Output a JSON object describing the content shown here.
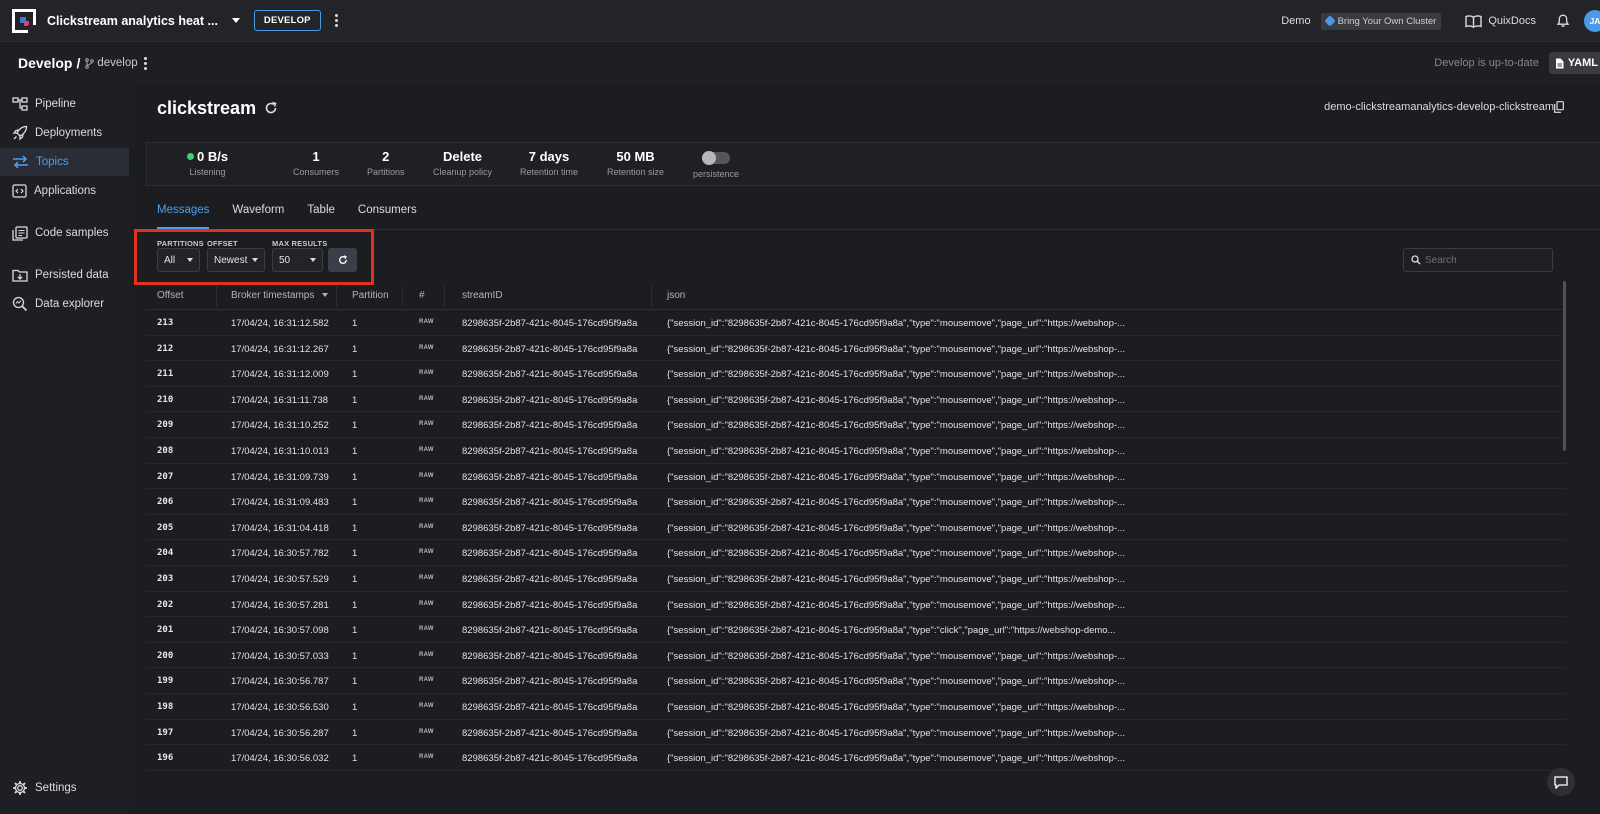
{
  "topbar": {
    "project_title": "Clickstream analytics heat ...",
    "environment_badge": "DEVELOP",
    "org_label": "Demo",
    "byoc_label": "Bring Your Own Cluster",
    "docs_label": "QuixDocs",
    "avatar_initials": "JA"
  },
  "subbar": {
    "crumb_root": "Develop",
    "crumb_separator": "/",
    "branch": "develop",
    "status": "Develop is up-to-date",
    "yaml_label": "YAML"
  },
  "sidebar": {
    "items": [
      {
        "label": "Pipeline",
        "icon": "pipeline-icon"
      },
      {
        "label": "Deployments",
        "icon": "rocket-icon"
      },
      {
        "label": "Topics",
        "icon": "topics-icon",
        "active": true
      },
      {
        "label": "Applications",
        "icon": "applications-icon"
      },
      {
        "label": "Code samples",
        "icon": "code-samples-icon"
      },
      {
        "label": "Persisted data",
        "icon": "persisted-data-icon"
      },
      {
        "label": "Data explorer",
        "icon": "data-explorer-icon"
      }
    ],
    "settings_label": "Settings"
  },
  "topic": {
    "name": "clickstream",
    "full_id": "demo-clickstreamanalytics-develop-clickstream"
  },
  "stats": {
    "throughput": {
      "value": "0 B/s",
      "label": "Listening"
    },
    "consumers": {
      "value": "1",
      "label": "Consumers"
    },
    "partitions": {
      "value": "2",
      "label": "Partitions"
    },
    "cleanup": {
      "value": "Delete",
      "label": "Cleanup policy"
    },
    "retention_time": {
      "value": "7 days",
      "label": "Retention time"
    },
    "retention_size": {
      "value": "50 MB",
      "label": "Retention size"
    },
    "persistence": {
      "label": "persistence",
      "enabled": false
    }
  },
  "tabs": [
    "Messages",
    "Waveform",
    "Table",
    "Consumers"
  ],
  "active_tab": "Messages",
  "filters": {
    "partitions": {
      "label": "PARTITIONS",
      "value": "All"
    },
    "offset": {
      "label": "OFFSET",
      "value": "Newest"
    },
    "max_results": {
      "label": "MAX RESULTS",
      "value": "50"
    },
    "search_placeholder": "Search"
  },
  "table": {
    "columns": [
      "Offset",
      "Broker timestamps",
      "Partition",
      "#",
      "streamID",
      "json"
    ],
    "rows": [
      {
        "offset": "213",
        "ts": "17/04/24, 16:31:12.582",
        "partition": "1",
        "fmt": "RAW",
        "stream": "8298635f-2b87-421c-8045-176cd95f9a8a",
        "json": "{\"session_id\":\"8298635f-2b87-421c-8045-176cd95f9a8a\",\"type\":\"mousemove\",\"page_url\":\"https://webshop-..."
      },
      {
        "offset": "212",
        "ts": "17/04/24, 16:31:12.267",
        "partition": "1",
        "fmt": "RAW",
        "stream": "8298635f-2b87-421c-8045-176cd95f9a8a",
        "json": "{\"session_id\":\"8298635f-2b87-421c-8045-176cd95f9a8a\",\"type\":\"mousemove\",\"page_url\":\"https://webshop-..."
      },
      {
        "offset": "211",
        "ts": "17/04/24, 16:31:12.009",
        "partition": "1",
        "fmt": "RAW",
        "stream": "8298635f-2b87-421c-8045-176cd95f9a8a",
        "json": "{\"session_id\":\"8298635f-2b87-421c-8045-176cd95f9a8a\",\"type\":\"mousemove\",\"page_url\":\"https://webshop-..."
      },
      {
        "offset": "210",
        "ts": "17/04/24, 16:31:11.738",
        "partition": "1",
        "fmt": "RAW",
        "stream": "8298635f-2b87-421c-8045-176cd95f9a8a",
        "json": "{\"session_id\":\"8298635f-2b87-421c-8045-176cd95f9a8a\",\"type\":\"mousemove\",\"page_url\":\"https://webshop-..."
      },
      {
        "offset": "209",
        "ts": "17/04/24, 16:31:10.252",
        "partition": "1",
        "fmt": "RAW",
        "stream": "8298635f-2b87-421c-8045-176cd95f9a8a",
        "json": "{\"session_id\":\"8298635f-2b87-421c-8045-176cd95f9a8a\",\"type\":\"mousemove\",\"page_url\":\"https://webshop-..."
      },
      {
        "offset": "208",
        "ts": "17/04/24, 16:31:10.013",
        "partition": "1",
        "fmt": "RAW",
        "stream": "8298635f-2b87-421c-8045-176cd95f9a8a",
        "json": "{\"session_id\":\"8298635f-2b87-421c-8045-176cd95f9a8a\",\"type\":\"mousemove\",\"page_url\":\"https://webshop-..."
      },
      {
        "offset": "207",
        "ts": "17/04/24, 16:31:09.739",
        "partition": "1",
        "fmt": "RAW",
        "stream": "8298635f-2b87-421c-8045-176cd95f9a8a",
        "json": "{\"session_id\":\"8298635f-2b87-421c-8045-176cd95f9a8a\",\"type\":\"mousemove\",\"page_url\":\"https://webshop-..."
      },
      {
        "offset": "206",
        "ts": "17/04/24, 16:31:09.483",
        "partition": "1",
        "fmt": "RAW",
        "stream": "8298635f-2b87-421c-8045-176cd95f9a8a",
        "json": "{\"session_id\":\"8298635f-2b87-421c-8045-176cd95f9a8a\",\"type\":\"mousemove\",\"page_url\":\"https://webshop-..."
      },
      {
        "offset": "205",
        "ts": "17/04/24, 16:31:04.418",
        "partition": "1",
        "fmt": "RAW",
        "stream": "8298635f-2b87-421c-8045-176cd95f9a8a",
        "json": "{\"session_id\":\"8298635f-2b87-421c-8045-176cd95f9a8a\",\"type\":\"mousemove\",\"page_url\":\"https://webshop-..."
      },
      {
        "offset": "204",
        "ts": "17/04/24, 16:30:57.782",
        "partition": "1",
        "fmt": "RAW",
        "stream": "8298635f-2b87-421c-8045-176cd95f9a8a",
        "json": "{\"session_id\":\"8298635f-2b87-421c-8045-176cd95f9a8a\",\"type\":\"mousemove\",\"page_url\":\"https://webshop-..."
      },
      {
        "offset": "203",
        "ts": "17/04/24, 16:30:57.529",
        "partition": "1",
        "fmt": "RAW",
        "stream": "8298635f-2b87-421c-8045-176cd95f9a8a",
        "json": "{\"session_id\":\"8298635f-2b87-421c-8045-176cd95f9a8a\",\"type\":\"mousemove\",\"page_url\":\"https://webshop-..."
      },
      {
        "offset": "202",
        "ts": "17/04/24, 16:30:57.281",
        "partition": "1",
        "fmt": "RAW",
        "stream": "8298635f-2b87-421c-8045-176cd95f9a8a",
        "json": "{\"session_id\":\"8298635f-2b87-421c-8045-176cd95f9a8a\",\"type\":\"mousemove\",\"page_url\":\"https://webshop-..."
      },
      {
        "offset": "201",
        "ts": "17/04/24, 16:30:57.098",
        "partition": "1",
        "fmt": "RAW",
        "stream": "8298635f-2b87-421c-8045-176cd95f9a8a",
        "json": "{\"session_id\":\"8298635f-2b87-421c-8045-176cd95f9a8a\",\"type\":\"click\",\"page_url\":\"https://webshop-demo..."
      },
      {
        "offset": "200",
        "ts": "17/04/24, 16:30:57.033",
        "partition": "1",
        "fmt": "RAW",
        "stream": "8298635f-2b87-421c-8045-176cd95f9a8a",
        "json": "{\"session_id\":\"8298635f-2b87-421c-8045-176cd95f9a8a\",\"type\":\"mousemove\",\"page_url\":\"https://webshop-..."
      },
      {
        "offset": "199",
        "ts": "17/04/24, 16:30:56.787",
        "partition": "1",
        "fmt": "RAW",
        "stream": "8298635f-2b87-421c-8045-176cd95f9a8a",
        "json": "{\"session_id\":\"8298635f-2b87-421c-8045-176cd95f9a8a\",\"type\":\"mousemove\",\"page_url\":\"https://webshop-..."
      },
      {
        "offset": "198",
        "ts": "17/04/24, 16:30:56.530",
        "partition": "1",
        "fmt": "RAW",
        "stream": "8298635f-2b87-421c-8045-176cd95f9a8a",
        "json": "{\"session_id\":\"8298635f-2b87-421c-8045-176cd95f9a8a\",\"type\":\"mousemove\",\"page_url\":\"https://webshop-..."
      },
      {
        "offset": "197",
        "ts": "17/04/24, 16:30:56.287",
        "partition": "1",
        "fmt": "RAW",
        "stream": "8298635f-2b87-421c-8045-176cd95f9a8a",
        "json": "{\"session_id\":\"8298635f-2b87-421c-8045-176cd95f9a8a\",\"type\":\"mousemove\",\"page_url\":\"https://webshop-..."
      },
      {
        "offset": "196",
        "ts": "17/04/24, 16:30:56.032",
        "partition": "1",
        "fmt": "RAW",
        "stream": "8298635f-2b87-421c-8045-176cd95f9a8a",
        "json": "{\"session_id\":\"8298635f-2b87-421c-8045-176cd95f9a8a\",\"type\":\"mousemove\",\"page_url\":\"https://webshop-..."
      }
    ]
  },
  "colors": {
    "accent": "#4aa0f0",
    "highlight_box": "#e0301e",
    "status_ok": "#3ecf7a"
  }
}
